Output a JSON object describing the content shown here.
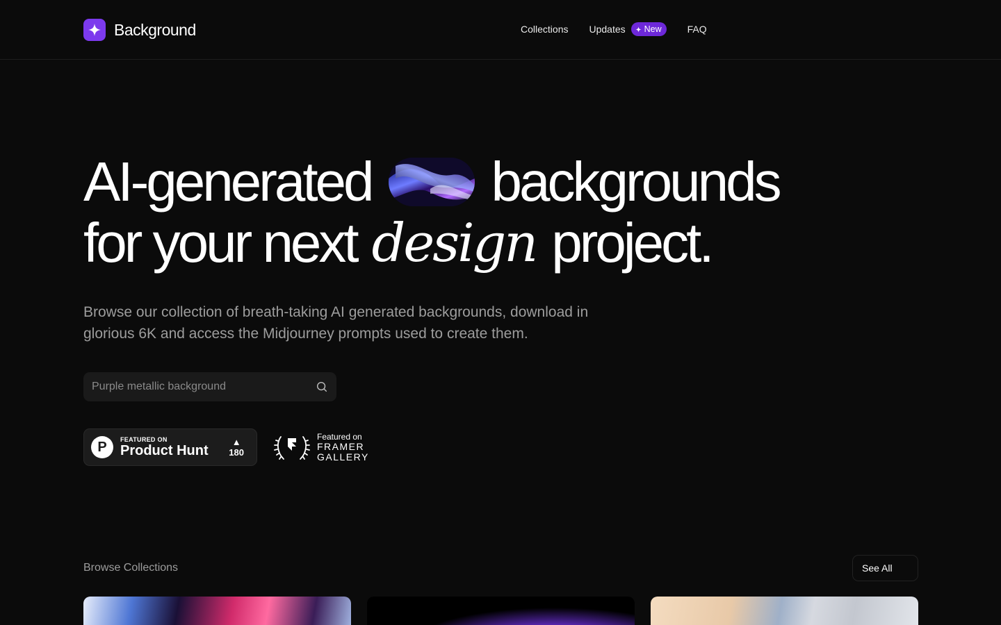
{
  "brand": {
    "name": "Background"
  },
  "nav": {
    "collections": "Collections",
    "updates": "Updates",
    "badge_new": "New",
    "faq": "FAQ"
  },
  "hero": {
    "line1_a": "AI-generated",
    "line1_b": "backgrounds",
    "line2_a": "for your next",
    "line2_italic": "design",
    "line2_b": "project.",
    "subtitle": "Browse our collection of breath-taking AI generated backgrounds, download in glorious 6K and access the Midjourney prompts used to create them."
  },
  "search": {
    "placeholder": "Purple metallic background",
    "icon": "search-icon"
  },
  "product_hunt": {
    "small": "FEATURED ON",
    "big": "Product Hunt",
    "votes": "180",
    "logo_letter": "P"
  },
  "framer": {
    "small": "Featured on",
    "line1": "FRAMER",
    "line2": "GALLERY"
  },
  "collections": {
    "label": "Browse Collections",
    "see_all": "See All"
  },
  "colors": {
    "accent": "#7c3aed",
    "badge": "#6d28d9",
    "background": "#0b0b0b"
  }
}
